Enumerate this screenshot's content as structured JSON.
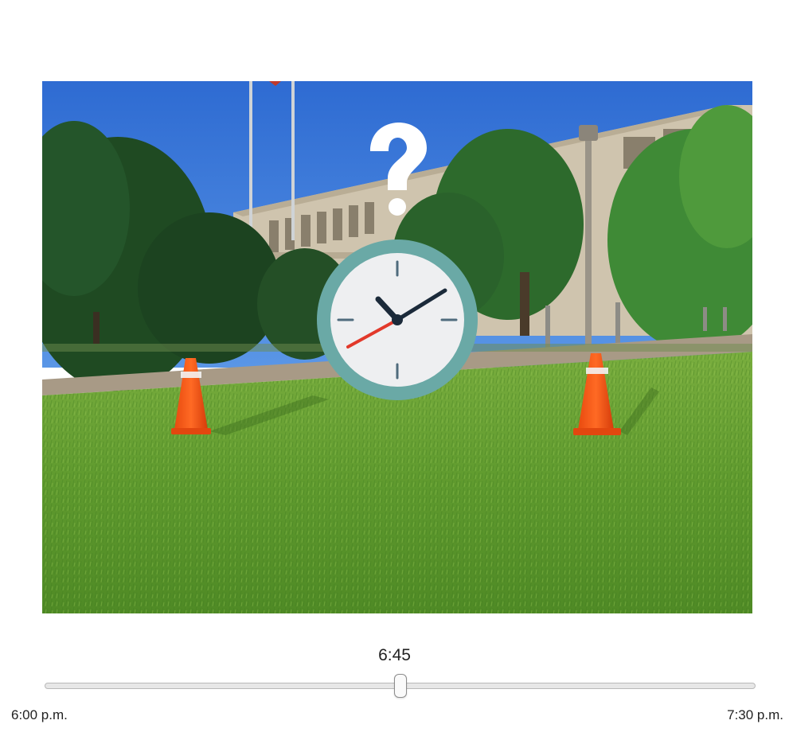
{
  "question": {
    "current_time_text": "6:45",
    "slider": {
      "value_fraction": 0.5,
      "min_label": "6:00 p.m.",
      "max_label": "7:30 p.m."
    }
  },
  "scene": {
    "overlay_icons": [
      "question-mark-icon",
      "clock-icon"
    ],
    "clock_face": {
      "hour": 10,
      "minute": 10,
      "second_hand_pointing": "8"
    },
    "colors": {
      "sky": "#2f6fd6",
      "grass": "#6fa63a",
      "cone": "#ff5a1a",
      "clock_rim": "#6aa9a6",
      "clock_face": "#f0f1f3",
      "clock_hands": "#1b2a3a",
      "second_hand": "#e2392b"
    }
  }
}
